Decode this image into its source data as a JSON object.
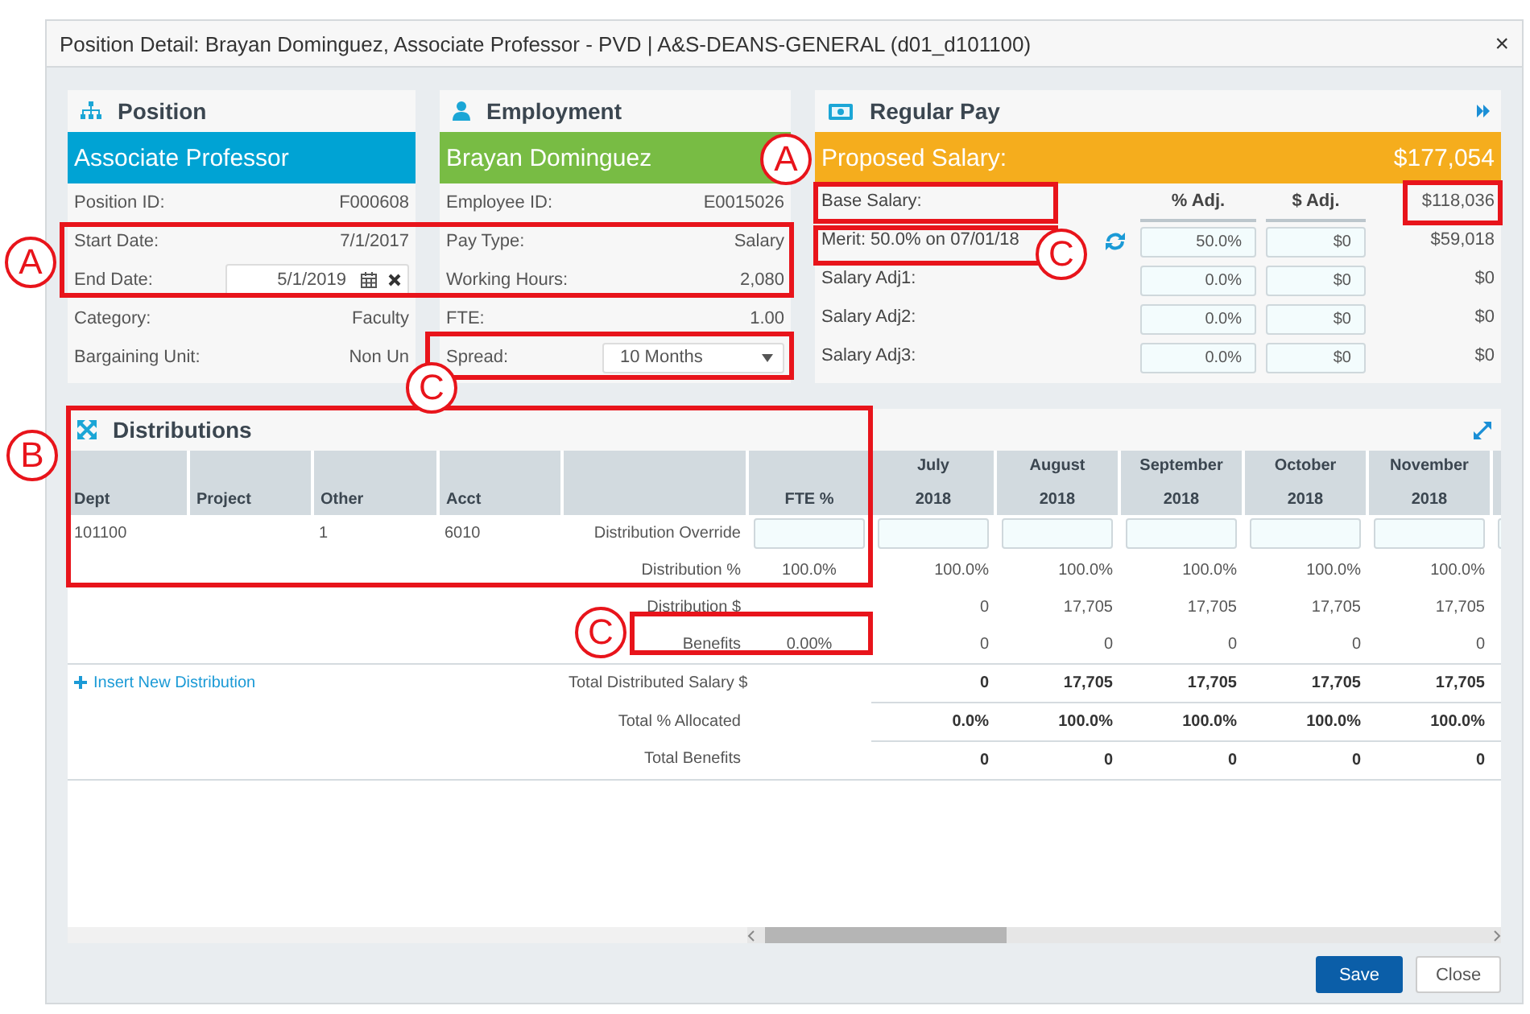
{
  "dialog": {
    "title": "Position Detail: Brayan Dominguez, Associate Professor - PVD | A&S-DEANS-GENERAL (d01_d101100)",
    "close": "×"
  },
  "position": {
    "title": "Position",
    "banner": "Associate Professor",
    "fields": [
      {
        "label": "Position ID:",
        "value": "F000608",
        "kind": "text"
      },
      {
        "label": "Start Date:",
        "value": "7/1/2017",
        "kind": "text"
      },
      {
        "label": "End Date:",
        "value": "5/1/2019",
        "kind": "date"
      },
      {
        "label": "Category:",
        "value": "Faculty",
        "kind": "text"
      },
      {
        "label": "Bargaining Unit:",
        "value": "Non Un",
        "kind": "text"
      }
    ]
  },
  "employment": {
    "title": "Employment",
    "banner": "Brayan Dominguez",
    "fields": [
      {
        "label": "Employee ID:",
        "value": "E0015026",
        "kind": "text"
      },
      {
        "label": "Pay Type:",
        "value": "Salary",
        "kind": "text"
      },
      {
        "label": "Working Hours:",
        "value": "2,080",
        "kind": "text"
      },
      {
        "label": "FTE:",
        "value": "1.00",
        "kind": "text"
      },
      {
        "label": "Spread:",
        "value": "10 Months",
        "kind": "select"
      }
    ]
  },
  "regular_pay": {
    "title": "Regular Pay",
    "banner_label": "Proposed Salary:",
    "banner_value": "$177,054",
    "base_label": "Base Salary:",
    "pct_header": "% Adj.",
    "amt_header": "$ Adj.",
    "base_value": "$118,036",
    "adjustments": [
      {
        "label": "Merit: 50.0% on 07/01/18",
        "refresh": true,
        "pct": "50.0%",
        "amount": "$0",
        "total": "$59,018"
      },
      {
        "label": "Salary Adj1:",
        "refresh": false,
        "pct": "0.0%",
        "amount": "$0",
        "total": "$0"
      },
      {
        "label": "Salary Adj2:",
        "refresh": false,
        "pct": "0.0%",
        "amount": "$0",
        "total": "$0"
      },
      {
        "label": "Salary Adj3:",
        "refresh": false,
        "pct": "0.0%",
        "amount": "$0",
        "total": "$0"
      }
    ]
  },
  "distributions": {
    "title": "Distributions",
    "key_columns": [
      "Dept",
      "Project",
      "Other",
      "Acct"
    ],
    "fte_header": "FTE %",
    "months": [
      {
        "month": "July",
        "year": "2018"
      },
      {
        "month": "August",
        "year": "2018"
      },
      {
        "month": "September",
        "year": "2018"
      },
      {
        "month": "October",
        "year": "2018"
      },
      {
        "month": "November",
        "year": "2018"
      }
    ],
    "row": {
      "dept": "101100",
      "other": "1",
      "acct": "6010"
    },
    "lines": [
      {
        "label": "Distribution Override",
        "kind": "input"
      },
      {
        "label": "Distribution %",
        "kind": "values",
        "fte": "100.0%",
        "values": [
          "100.0%",
          "100.0%",
          "100.0%",
          "100.0%",
          "100.0%"
        ]
      },
      {
        "label": "Distribution $",
        "kind": "values",
        "values": [
          "0",
          "17,705",
          "17,705",
          "17,705",
          "17,705"
        ]
      },
      {
        "label": "Benefits",
        "kind": "values",
        "fte": "0.00%",
        "values": [
          "0",
          "0",
          "0",
          "0",
          "0"
        ]
      }
    ],
    "insert_link": "Insert New Distribution",
    "totals": [
      {
        "label": "Total Distributed Salary $",
        "values": [
          "0",
          "17,705",
          "17,705",
          "17,705",
          "17,705"
        ]
      },
      {
        "label": "Total % Allocated",
        "values": [
          "0.0%",
          "100.0%",
          "100.0%",
          "100.0%",
          "100.0%"
        ]
      },
      {
        "label": "Total Benefits",
        "values": [
          "0",
          "0",
          "0",
          "0",
          "0"
        ]
      }
    ]
  },
  "buttons": [
    {
      "label": "Save",
      "kind": "primary"
    },
    {
      "label": "Close",
      "kind": "secondary"
    }
  ],
  "annotations": [
    {
      "label": "A"
    },
    {
      "label": "C"
    },
    {
      "label": "A"
    },
    {
      "label": "C"
    },
    {
      "label": "B"
    },
    {
      "label": "C"
    }
  ]
}
